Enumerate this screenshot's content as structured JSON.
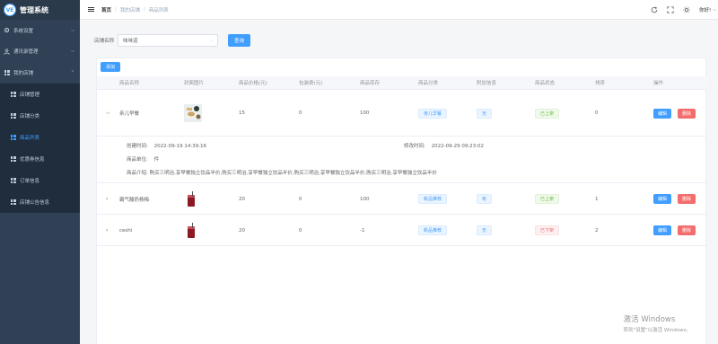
{
  "app": {
    "logo_mark": "VE",
    "title": "管理系统"
  },
  "sidebar": {
    "items": [
      {
        "label": "系统设置",
        "arrow": "⌵"
      },
      {
        "label": "通讯录管理",
        "arrow": "⌵"
      },
      {
        "label": "我的店铺",
        "arrow": "⌃"
      }
    ],
    "sub_items": [
      {
        "label": "店铺管理"
      },
      {
        "label": "店铺分类"
      },
      {
        "label": "商品列表"
      },
      {
        "label": "优惠券信息"
      },
      {
        "label": "订单信息"
      },
      {
        "label": "店铺公告信息"
      }
    ]
  },
  "header": {
    "breadcrumb": [
      "首页",
      "我的店铺",
      "商品列表"
    ],
    "separator": "/",
    "user": "你好!",
    "user_caret": "⌵"
  },
  "search": {
    "label": "店铺名称",
    "value": "味味道",
    "caret": "⌵",
    "button": "查询"
  },
  "table": {
    "add_button": "添加",
    "headers": [
      "商品名称",
      "封面图片",
      "商品价格(元)",
      "包装费(元)",
      "商品库存",
      "商品分类",
      "附加信息",
      "商品状态",
      "排序",
      "操作"
    ],
    "rows": [
      {
        "expanded": true,
        "arrow": "⌵",
        "name": "亲儿早餐",
        "price": "15",
        "packing": "0",
        "stock": "100",
        "category": "亲儿早餐",
        "extra": "无",
        "status": "已上架",
        "status_color": "green",
        "sort": "0",
        "edit": "编辑",
        "delete": "删除"
      },
      {
        "expanded": false,
        "arrow": "›",
        "name": "霸气酸奶杨梅",
        "price": "20",
        "packing": "0",
        "stock": "100",
        "category": "新品推荐",
        "extra": "有",
        "status": "已上架",
        "status_color": "green",
        "sort": "1",
        "edit": "编辑",
        "delete": "删除"
      },
      {
        "expanded": false,
        "arrow": "›",
        "name": "ceshi",
        "price": "20",
        "packing": "0",
        "stock": "-1",
        "category": "新品推荐",
        "extra": "无",
        "status": "已下架",
        "status_color": "red",
        "sort": "2",
        "edit": "编辑",
        "delete": "删除"
      }
    ],
    "detail": {
      "created_label": "创建时间:",
      "created": "2022-09-19 14:39:16",
      "modified_label": "修改时间:",
      "modified": "2022-09-29 09:23:02",
      "unit_label": "商品单位:",
      "unit": "件",
      "intro_label": "商品介绍:",
      "intro": "购买三明治,享早餐独立饮品半价,购买三明治,享早餐独立饮品半价,购买三明治,享早餐独立饮品半价,购买三明治,享早餐独立饮品半价"
    }
  },
  "watermark": {
    "line1": "激活 Windows",
    "line2": "转到\"设置\"以激活 Windows。"
  },
  "colors": {
    "sidebar_bg": "#304156",
    "primary": "#409eff",
    "danger": "#f56c6c",
    "success": "#67c23a"
  }
}
